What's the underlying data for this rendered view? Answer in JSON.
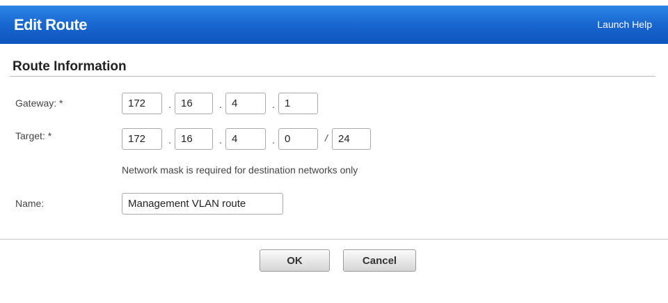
{
  "header": {
    "title": "Edit Route",
    "help_label": "Launch Help"
  },
  "section": {
    "title": "Route Information"
  },
  "gateway": {
    "label": "Gateway: *",
    "octets": [
      "172",
      "16",
      "4",
      "1"
    ]
  },
  "target": {
    "label": "Target: *",
    "octets": [
      "172",
      "16",
      "4",
      "0"
    ],
    "prefix": "24"
  },
  "separators": {
    "dot": ".",
    "slash": "/"
  },
  "hint": "Network mask is required for destination networks only",
  "name_field": {
    "label": "Name:",
    "value": "Management VLAN route"
  },
  "buttons": {
    "ok": "OK",
    "cancel": "Cancel"
  }
}
